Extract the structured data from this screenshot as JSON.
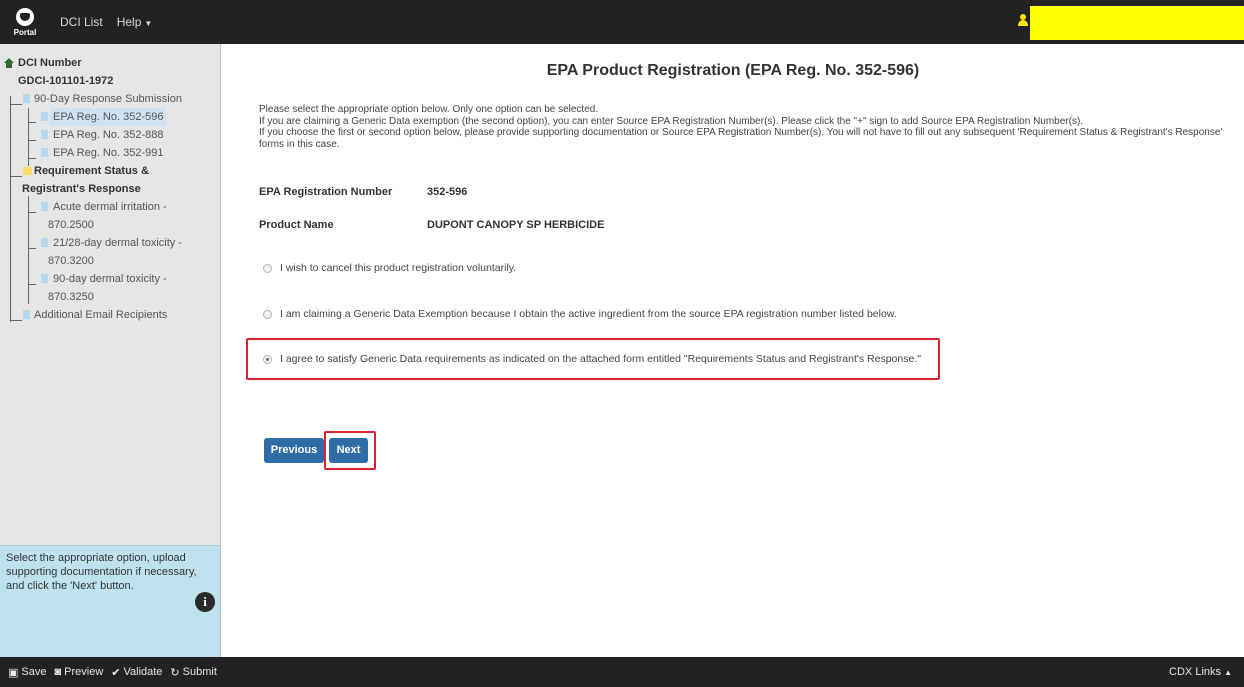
{
  "topbar": {
    "logo_text": "Portal",
    "nav": [
      "DCI List",
      "Help"
    ]
  },
  "sidebar": {
    "root_label": "DCI Number",
    "dci_number": "GDCI-101101-1972",
    "group_90day": "90-Day Response Submission",
    "epa_items": [
      "EPA Reg. No. 352-596",
      "EPA Reg. No. 352-888",
      "EPA Reg. No. 352-991"
    ],
    "req_status_line1": "Requirement Status &",
    "req_status_line2": "Registrant's Response",
    "req_items": [
      {
        "name": "Acute dermal irritation -",
        "code": "870.2500"
      },
      {
        "name": "21/28-day dermal toxicity -",
        "code": "870.3200"
      },
      {
        "name": "90-day dermal toxicity -",
        "code": "870.3250"
      }
    ],
    "additional": "Additional Email Recipients",
    "help_text": "Select the appropriate option, upload supporting documentation if necessary, and click the 'Next' button."
  },
  "main": {
    "title": "EPA Product Registration (EPA Reg. No. 352-596)",
    "instructions": [
      "Please select the appropriate option below. Only one option can be selected.",
      "If you are claiming a Generic Data exemption (the second option), you can enter Source EPA Registration Number(s). Please click the \"+\" sign to add Source EPA Registration Number(s).",
      "If you choose the first or second option below, please provide supporting documentation or Source EPA Registration Number(s). You will not have to fill out any subsequent 'Requirement Status & Registrant's Response' forms in this case."
    ],
    "reg_number_label": "EPA Registration Number",
    "reg_number_value": "352-596",
    "product_name_label": "Product Name",
    "product_name_value": "DUPONT CANOPY SP HERBICIDE",
    "options": [
      "I wish to cancel this product registration voluntarily.",
      "I am claiming a Generic Data Exemption because I obtain the active ingredient from the source EPA registration number listed below.",
      "I agree to satisfy Generic Data requirements as indicated on the attached form entitled \"Requirements Status and Registrant's Response.\""
    ],
    "selected_option": 2,
    "previous_label": "Previous",
    "next_label": "Next"
  },
  "bottombar": {
    "save": "Save",
    "preview": "Preview",
    "validate": "Validate",
    "submit": "Submit",
    "cdx_links": "CDX Links"
  },
  "colors": {
    "navbar": "#222222",
    "sidebar": "#e6e6e6",
    "help_box": "#bfe3ee",
    "button": "#2f6da7",
    "highlight": "#d9232e",
    "user_box": "#ffff00"
  }
}
